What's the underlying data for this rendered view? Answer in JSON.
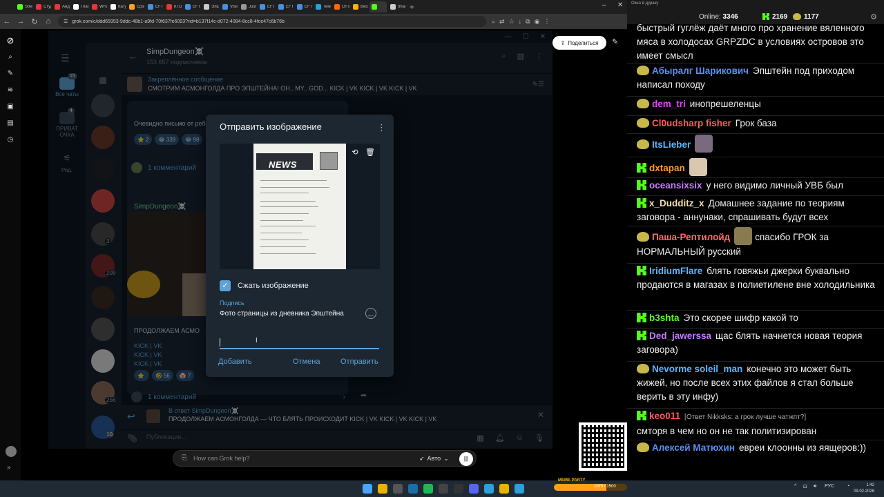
{
  "browser": {
    "tabs": [
      "Strea",
      "Студ",
      "Анд",
      "Глав",
      "WHA",
      "Катус",
      "Epste",
      "EFTA",
      "КТО",
      "EFTA",
      "Эпш",
      "Visio",
      "Justic",
      "EFTA",
      "EFTA",
      "EFTA",
      "Teleg",
      "От в",
      "Весь",
      "",
      "Imagi"
    ],
    "tab_colors": [
      "#53fc18",
      "#e53935",
      "#e53935",
      "#fff",
      "#e53935",
      "#fff",
      "#f7a128",
      "#4a90e2",
      "#e53935",
      "#4a90e2",
      "#ccc",
      "#4a90e2",
      "#999",
      "#4a90e2",
      "#4a90e2",
      "#4a90e2",
      "#2aa1da",
      "#ff6a00",
      "#ffb300",
      "#53fc18",
      "#ccc"
    ],
    "active_tab_index": 19,
    "url": "grok.com/c/ddd65953-9ddc-48b1-a9fd-70f637fe6093?rid=b137f14c-d072-4084-8cc8-4fce47c6b76b",
    "share_label": "Поделиться"
  },
  "telegram": {
    "folders": [
      {
        "label": "Все чаты",
        "badge": "15"
      },
      {
        "label": "ПРИВАТ ОЧКА",
        "badge": "4"
      },
      {
        "label": "Ред.",
        "badge": ""
      }
    ],
    "chatlist_badges": [
      "3",
      "209",
      "256",
      "10"
    ],
    "channel_title": "SimpDungeon☠️",
    "channel_subtitle": "153 657 подписчиков",
    "pinned_title": "Закреплённое сообщение",
    "pinned_text": "СМОТРИМ АСМОНГОЛДА ПРО ЭПШТЕЙНА! ОН.. MY.. GOD...  KICK | VK KICK | VK KICK | VK",
    "msg1_text": "Очевидно письмо от ребенка Эпштейну",
    "msg1_reactions": [
      {
        "emoji": "⭐",
        "count": "2"
      },
      {
        "emoji": "😂",
        "count": "339"
      },
      {
        "emoji": "😂",
        "count": "98"
      }
    ],
    "comments_label": "1 комментарий",
    "msg2_author": "SimpDungeon☠️",
    "msg2_text": "ПРОДОЛЖАЕМ АСМО",
    "kick_lines": [
      "KICK | VK",
      "KICK | VK",
      "KICK | VK"
    ],
    "msg2_reactions": [
      {
        "emoji": "⭐",
        "count": ""
      },
      {
        "emoji": "🤣",
        "count": "56"
      },
      {
        "emoji": "🤡",
        "count": "7"
      }
    ],
    "comments2_label": "1 комментарий",
    "reply_title": "В ответ SimpDungeon☠️",
    "reply_text": "ПРОДОЛЖАЕМ АСМОНГОЛДА — ЧТО БЛЯТЬ ПРОИСХОДИТ  KICK | VK KICK | VK KICK | VK",
    "compose_placeholder": "Публикация..."
  },
  "dialog": {
    "title": "Отправить изображение",
    "compress_label": "Сжать изображение",
    "compress_checked": true,
    "caption_label": "Подпись",
    "caption_text": "Фото страницы из дневника Эпштейна",
    "add_button": "Добавить",
    "cancel_button": "Отмена",
    "send_button": "Отправить",
    "preview_headline": "NEWS"
  },
  "grok": {
    "prompt_placeholder": "How can Grok help?",
    "mode_label": "Авто"
  },
  "chat": {
    "header_tab": "Окно в дураку",
    "online_label": "Online:",
    "online_count": "3346",
    "kick_count": "2169",
    "duck_count": "1177",
    "messages": [
      {
        "badge": "",
        "nick": "",
        "color": "#eeeeee",
        "emote": "",
        "reply": "",
        "text": "быстрый гуглёж даёт много про хранение вяленного мяса в холодосах GRPZDC  в условиях островов это имеет смысл"
      },
      {
        "badge": "duck",
        "nick": "Абыралг Шарикович",
        "color": "#5b8ef0",
        "emote": "",
        "reply": "",
        "text": "Эпштейн под приходом написал походу"
      },
      {
        "badge": "duck",
        "nick": "dem_tri",
        "color": "#e040fb",
        "emote": "",
        "reply": "",
        "text": "инопрешеленцы"
      },
      {
        "badge": "duck",
        "nick": "Cl0udsharp fisher",
        "color": "#ff5c5c",
        "emote": "",
        "reply": "",
        "text": "Грок база"
      },
      {
        "badge": "duck",
        "nick": "ItsLieber",
        "color": "#5bb6ff",
        "emote": "anime",
        "reply": "",
        "text": ""
      },
      {
        "badge": "kick",
        "nick": "dxtapan",
        "color": "#ff9a2e",
        "emote": "cat",
        "reply": "",
        "text": ""
      },
      {
        "badge": "kick",
        "nick": "oceansixsix",
        "color": "#c67cff",
        "emote": "",
        "reply": "",
        "text": "у него видимо личный УВБ был"
      },
      {
        "badge": "kick",
        "nick": "x_Dudditz_x",
        "color": "#f0e0b0",
        "emote": "",
        "reply": "",
        "text": "Домашнее задание по теориям заговора - аннунаки, спрашивать будут всех"
      },
      {
        "badge": "duck",
        "nick": "Паша-Рептилойд",
        "color": "#ff6b6b",
        "emote": "face",
        "reply": "",
        "text": "спасибо ГРОК за НОРМАЛЬНЫЙ русский"
      },
      {
        "badge": "kick",
        "nick": "IridiumFlare",
        "color": "#5bb6ff",
        "emote": "",
        "reply": "",
        "text": "блять говяжьи джерки буквально продаются в магазах в полиетилене вне холодильника"
      },
      {
        "badge": "kick",
        "nick": "b3shta",
        "color": "#53fc18",
        "emote": "",
        "reply": "",
        "text": "Это скорее шифр какой то"
      },
      {
        "badge": "kick",
        "nick": "Ded_jawerssa",
        "color": "#c67cff",
        "emote": "",
        "reply": "",
        "text": "щас блять начнется новая теория заговора)"
      },
      {
        "badge": "duck",
        "nick": "Nevorme  soleil_man",
        "color": "#5bb6ff",
        "emote": "",
        "reply": "",
        "text": "конечно это может быть жижей, но после всех этих файлов я стал больше верить в эту инфу)"
      },
      {
        "badge": "kick",
        "nick": "keo011",
        "color": "#ff5c5c",
        "emote": "",
        "reply": "[Ответ Nikksks: а грок лучше чатжпт?]",
        "text": "смторя в чем но он не так политизирован"
      },
      {
        "badge": "duck",
        "nick": "Алексей Матюхин",
        "color": "#5b8ef0",
        "emote": "",
        "reply": "",
        "text": "евреи клоонны из яящеров:))"
      }
    ]
  },
  "overlay": {
    "meme_label": "MEME PARTY",
    "meme_count": "1075 / 1500",
    "meme_progress": 0.72
  },
  "taskbar": {
    "lang": "РУС",
    "time": "1:42",
    "date": "09.02.2026"
  }
}
